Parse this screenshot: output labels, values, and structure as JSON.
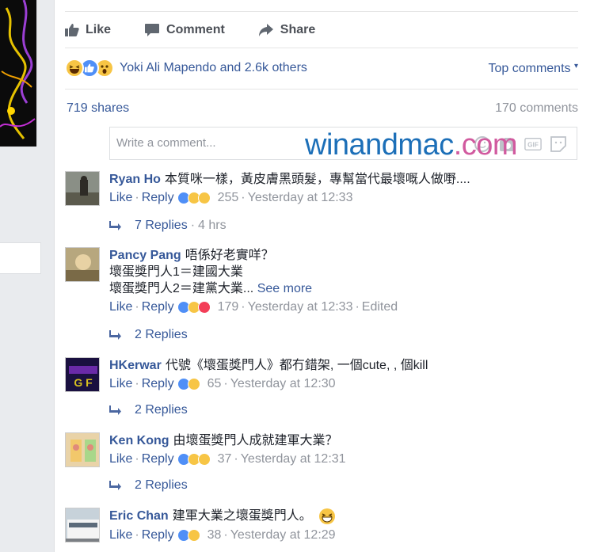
{
  "actions": {
    "like": "Like",
    "comment": "Comment",
    "share": "Share"
  },
  "reactions": {
    "names": "Yoki Ali Mapendo and 2.6k others",
    "top_comments": "Top comments"
  },
  "stats": {
    "shares": "719 shares",
    "comments": "170 comments"
  },
  "composer": {
    "placeholder": "Write a comment..."
  },
  "watermark": {
    "part1": "winandmac",
    "part2": ".com"
  },
  "comments": [
    {
      "author": "Ryan Ho",
      "text": "本質咪一樣，黃皮膚黑頭髮，專幫當代最壞嘅人做嘢....",
      "like": "Like",
      "reply": "Reply",
      "count": "255",
      "time": "Yesterday at 12:33",
      "replies": "7 Replies",
      "replies_time": "4 hrs"
    },
    {
      "author": "Pancy Pang",
      "text": "唔係好老實咩？",
      "line2": "壞蛋獎門人1＝建國大業",
      "line3": "壞蛋獎門人2＝建黨大業...",
      "see_more": "See more",
      "like": "Like",
      "reply": "Reply",
      "count": "179",
      "time": "Yesterday at 12:33",
      "edited": "Edited",
      "replies": "2 Replies"
    },
    {
      "author": "HKerwar",
      "text": "代號《壞蛋獎門人》都冇錯架, 一個cute, , 個kill",
      "like": "Like",
      "reply": "Reply",
      "count": "65",
      "time": "Yesterday at 12:30",
      "replies": "2 Replies"
    },
    {
      "author": "Ken Kong",
      "text": "由壞蛋獎門人成就建軍大業？",
      "like": "Like",
      "reply": "Reply",
      "count": "37",
      "time": "Yesterday at 12:31",
      "replies": "2 Replies"
    },
    {
      "author": "Eric Chan",
      "text": "建軍大業之壞蛋獎門人。",
      "like": "Like",
      "reply": "Reply",
      "count": "38",
      "time": "Yesterday at 12:29"
    }
  ],
  "colors": {
    "link": "#365899",
    "muted": "#90949c",
    "like_blue": "#4f8ff7",
    "haha_yellow": "#f7c545",
    "love_red": "#f33e58"
  }
}
